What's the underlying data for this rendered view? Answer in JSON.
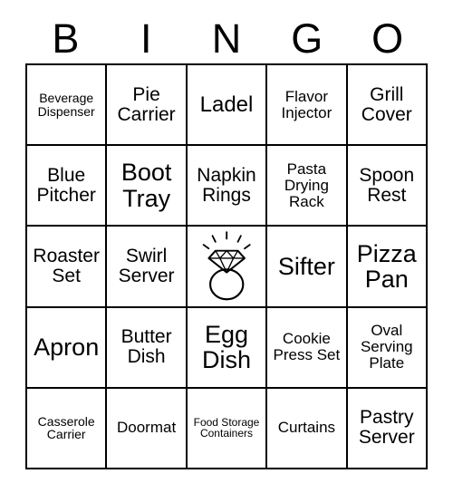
{
  "card": {
    "title_letters": [
      "B",
      "I",
      "N",
      "G",
      "O"
    ],
    "grid_size": "5x5",
    "background_color": "#ffffff",
    "line_color": "#000000",
    "text_color": "#000000"
  },
  "rows": [
    {
      "cells": [
        {
          "label": "Beverage Dispenser",
          "size": "xs",
          "type": "text"
        },
        {
          "label": "Pie Carrier",
          "size": "md",
          "type": "text"
        },
        {
          "label": "Ladel",
          "size": "lg",
          "type": "text"
        },
        {
          "label": "Flavor Injector",
          "size": "sm",
          "type": "text"
        },
        {
          "label": "Grill Cover",
          "size": "md",
          "type": "text"
        }
      ]
    },
    {
      "cells": [
        {
          "label": "Blue Pitcher",
          "size": "md",
          "type": "text"
        },
        {
          "label": "Boot Tray",
          "size": "xl",
          "type": "text"
        },
        {
          "label": "Napkin Rings",
          "size": "md",
          "type": "text"
        },
        {
          "label": "Pasta Drying Rack",
          "size": "sm",
          "type": "text"
        },
        {
          "label": "Spoon Rest",
          "size": "md",
          "type": "text"
        }
      ]
    },
    {
      "cells": [
        {
          "label": "Roaster Set",
          "size": "md",
          "type": "text"
        },
        {
          "label": "Swirl Server",
          "size": "md",
          "type": "text"
        },
        {
          "label": "",
          "size": "md",
          "type": "image",
          "image_name": "diamond-ring-free-space"
        },
        {
          "label": "Sifter",
          "size": "xl",
          "type": "text"
        },
        {
          "label": "Pizza Pan",
          "size": "xl",
          "type": "text"
        }
      ]
    },
    {
      "cells": [
        {
          "label": "Apron",
          "size": "xl",
          "type": "text"
        },
        {
          "label": "Butter Dish",
          "size": "md",
          "type": "text"
        },
        {
          "label": "Egg Dish",
          "size": "xl",
          "type": "text"
        },
        {
          "label": "Cookie Press Set",
          "size": "sm",
          "type": "text"
        },
        {
          "label": "Oval Serving Plate",
          "size": "sm",
          "type": "text"
        }
      ]
    },
    {
      "cells": [
        {
          "label": "Casserole Carrier",
          "size": "xs",
          "type": "text"
        },
        {
          "label": "Doormat",
          "size": "sm",
          "type": "text"
        },
        {
          "label": "Food Storage Containers",
          "size": "xxs",
          "type": "text"
        },
        {
          "label": "Curtains",
          "size": "sm",
          "type": "text"
        },
        {
          "label": "Pastry Server",
          "size": "md",
          "type": "text"
        }
      ]
    }
  ]
}
